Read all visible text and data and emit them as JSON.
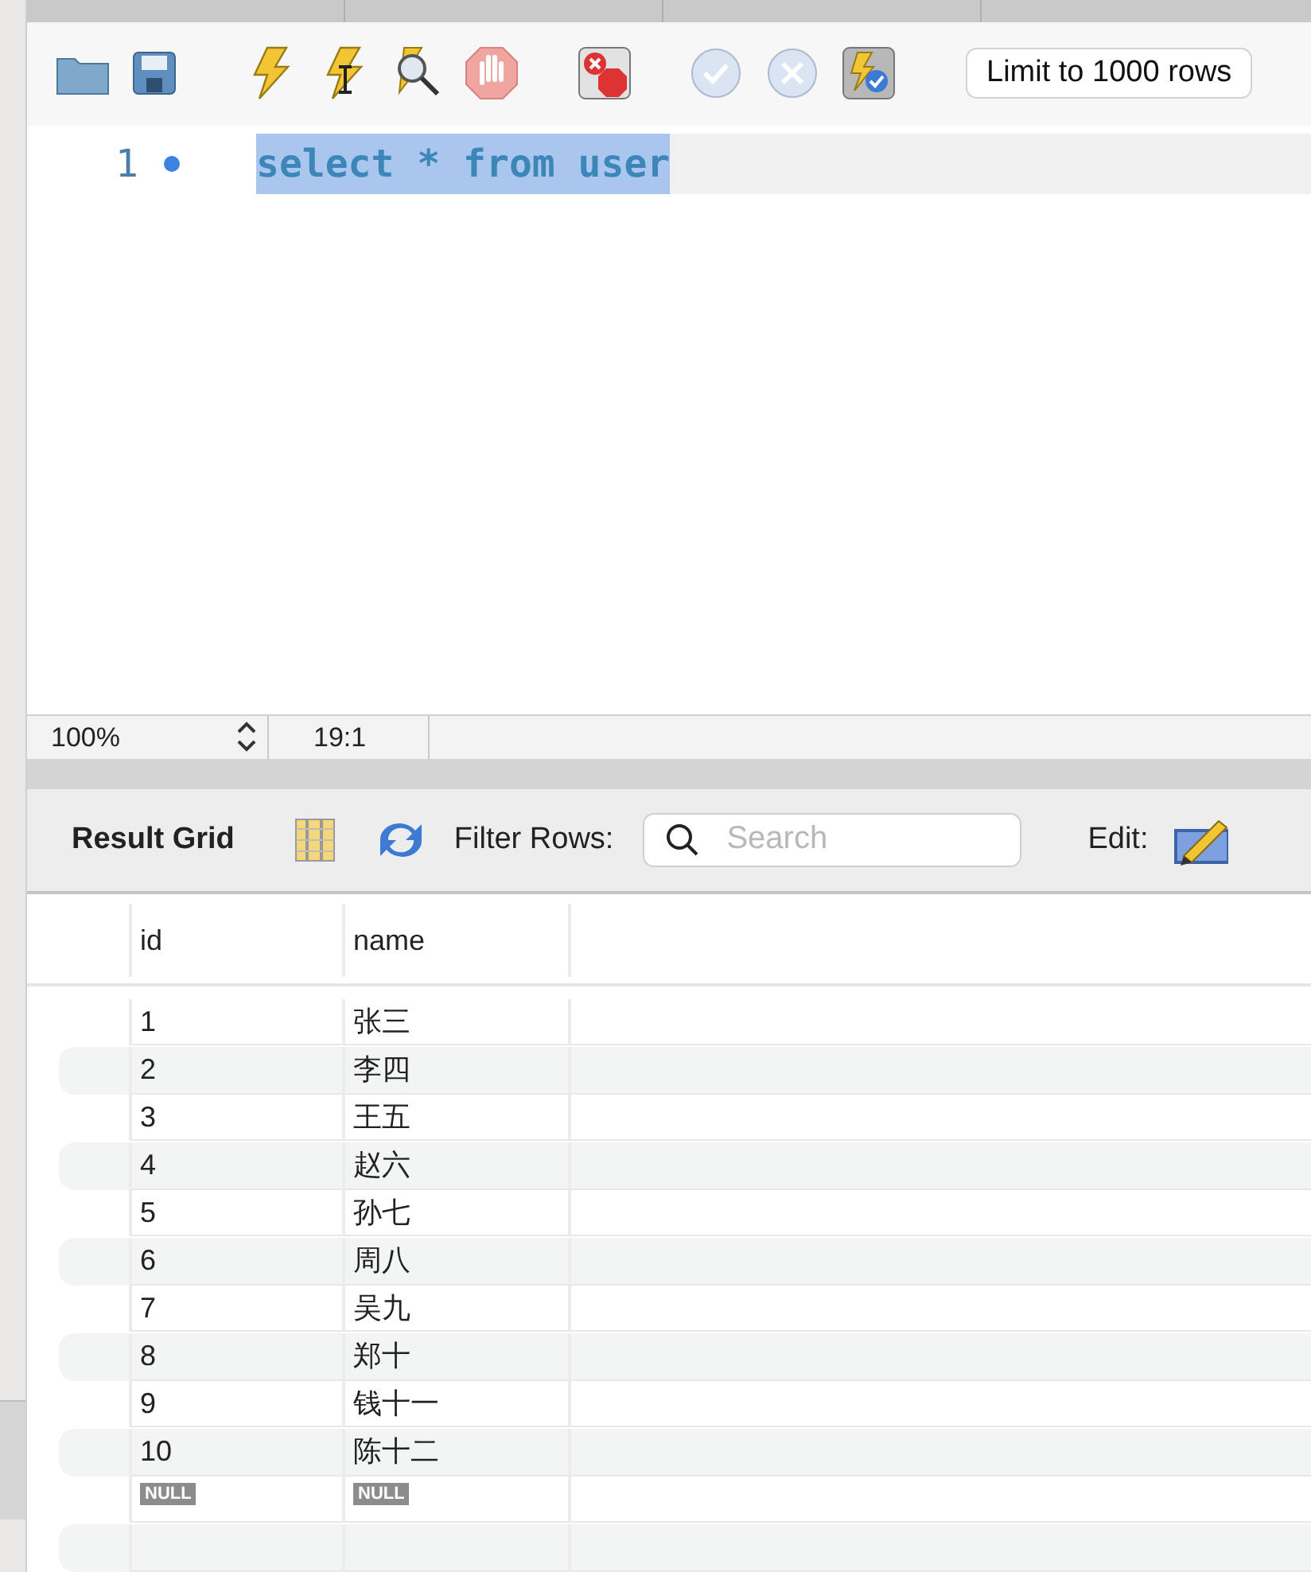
{
  "toolbar": {
    "limit": "Limit to 1000 rows"
  },
  "editor": {
    "lines": [
      {
        "number": "1",
        "text": "select * from user",
        "selected": true,
        "current": true
      }
    ]
  },
  "status_bar": {
    "zoom": "100%",
    "position": "19:1"
  },
  "result_toolbar": {
    "title": "Result Grid",
    "filter_label": "Filter Rows:",
    "search": {
      "placeholder": "Search"
    },
    "edit_label": "Edit:"
  },
  "grid": {
    "columns": [
      "id",
      "name"
    ],
    "rows": [
      {
        "kind": "value",
        "cells": [
          "1",
          "张三"
        ]
      },
      {
        "kind": "value",
        "cells": [
          "2",
          "李四"
        ]
      },
      {
        "kind": "value",
        "cells": [
          "3",
          "王五"
        ]
      },
      {
        "kind": "value",
        "cells": [
          "4",
          "赵六"
        ]
      },
      {
        "kind": "value",
        "cells": [
          "5",
          "孙七"
        ]
      },
      {
        "kind": "value",
        "cells": [
          "6",
          "周八"
        ]
      },
      {
        "kind": "value",
        "cells": [
          "7",
          "吴九"
        ]
      },
      {
        "kind": "value",
        "cells": [
          "8",
          "郑十"
        ]
      },
      {
        "kind": "value",
        "cells": [
          "9",
          "钱十一"
        ]
      },
      {
        "kind": "value",
        "cells": [
          "10",
          "陈十二"
        ]
      },
      {
        "kind": "null",
        "cells": [
          "NULL",
          "NULL"
        ]
      }
    ]
  }
}
